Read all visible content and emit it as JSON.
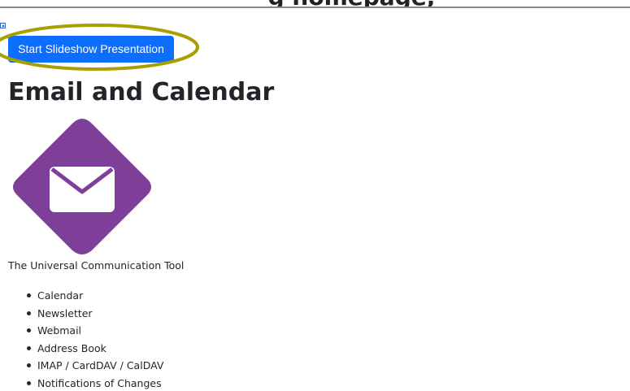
{
  "header": {
    "title_fragment": "g homepage,"
  },
  "toolbar": {
    "slideshow_toggle_icon": "play-square-icon",
    "start_button_label": "Start Slideshow Presentation",
    "button_color": "#0d6efd",
    "highlight_color": "#a8a000"
  },
  "main": {
    "heading": "Email and Calendar",
    "logo": {
      "icon": "envelope-icon",
      "background_color": "#7e3f98",
      "shape": "rounded-diamond"
    },
    "tagline": "The Universal Communication Tool",
    "features": [
      "Calendar",
      "Newsletter",
      "Webmail",
      "Address Book",
      "IMAP / CardDAV / CalDAV",
      "Notifications of Changes"
    ]
  }
}
